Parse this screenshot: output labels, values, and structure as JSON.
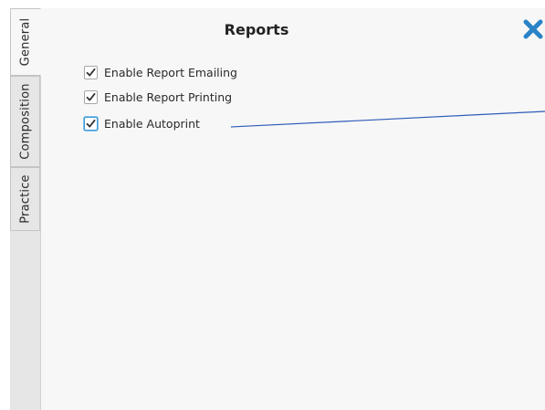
{
  "tabs": [
    {
      "label": "General",
      "active": true
    },
    {
      "label": "Composition",
      "active": false
    },
    {
      "label": "Practice",
      "active": false
    }
  ],
  "panel": {
    "title": "Reports",
    "close_icon": "close-x-icon"
  },
  "options": [
    {
      "label": "Enable Report Emailing",
      "checked": true
    },
    {
      "label": "Enable Report Printing",
      "checked": true
    },
    {
      "label": "Enable Autoprint",
      "checked": true,
      "focused": true
    }
  ],
  "colors": {
    "accent": "#2a83c6",
    "focus_ring": "#3b9ad9",
    "annotation_line": "#2f5bb8",
    "tab_bg": "#e6e6e6",
    "panel_bg": "#f7f7f7"
  }
}
